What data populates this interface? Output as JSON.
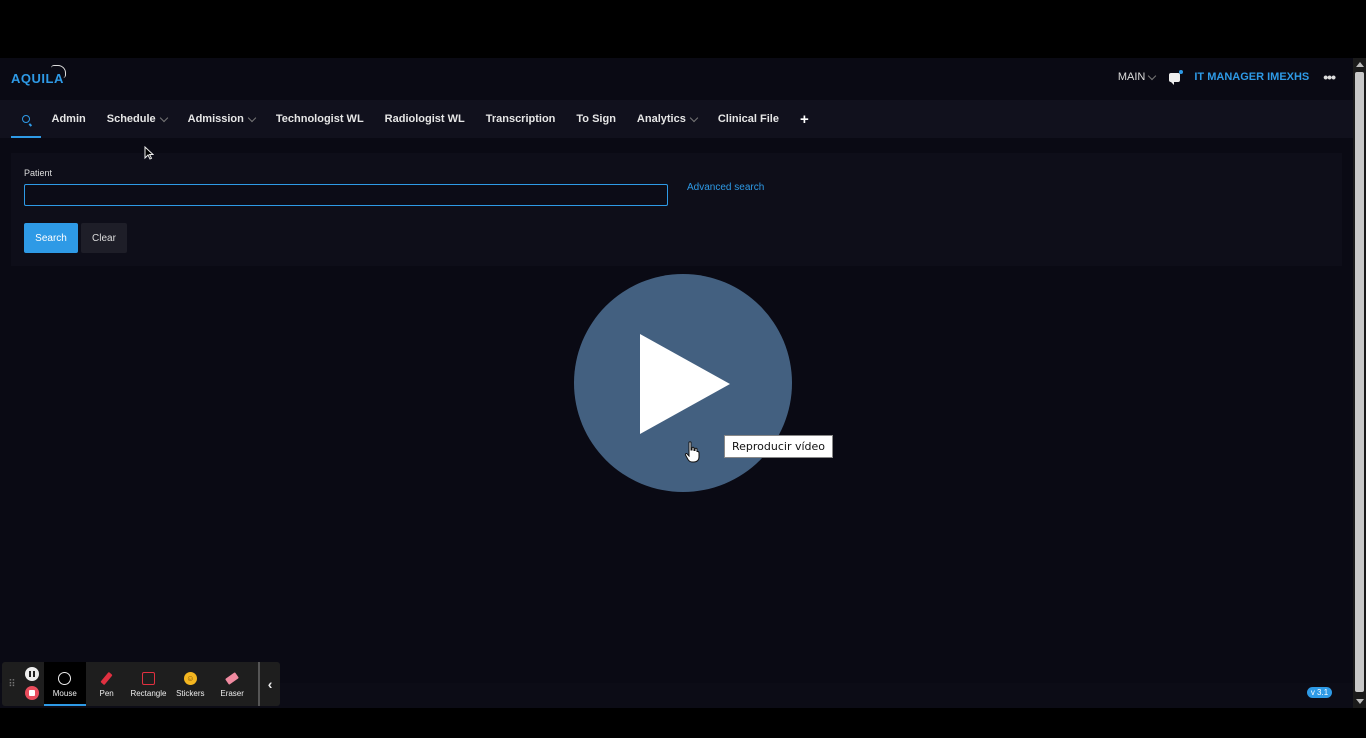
{
  "header": {
    "logo": "AQUILA",
    "main_label": "MAIN",
    "user_label": "IT MANAGER IMEXHS",
    "more_label": "•••"
  },
  "nav": {
    "items": [
      {
        "label": "Admin"
      },
      {
        "label": "Schedule"
      },
      {
        "label": "Admission"
      },
      {
        "label": "Technologist WL"
      },
      {
        "label": "Radiologist WL"
      },
      {
        "label": "Transcription"
      },
      {
        "label": "To Sign"
      },
      {
        "label": "Analytics"
      },
      {
        "label": "Clinical File"
      }
    ],
    "add_label": "+"
  },
  "search_panel": {
    "patient_label": "Patient",
    "patient_value": "",
    "advanced_link": "Advanced search",
    "search_button": "Search",
    "clear_button": "Clear"
  },
  "video": {
    "tooltip": "Reproducir vídeo"
  },
  "footer": {
    "version": "v 3.1"
  },
  "recording_toolbar": {
    "tools": [
      {
        "label": "Mouse"
      },
      {
        "label": "Pen"
      },
      {
        "label": "Rectangle"
      },
      {
        "label": "Stickers"
      },
      {
        "label": "Eraser"
      }
    ]
  },
  "colors": {
    "accent": "#2e9ae6",
    "background": "#0a0a14",
    "play_overlay": "#436080",
    "stop_red": "#e84c5c"
  }
}
